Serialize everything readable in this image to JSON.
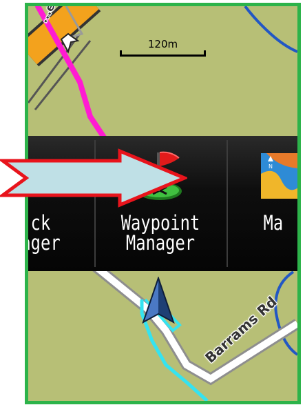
{
  "map": {
    "scale_label": "120m",
    "road_labels": {
      "top_street": "...ent Ra",
      "bottom_street": "Barrams Rd"
    }
  },
  "menu": {
    "items": [
      {
        "label": "ck\nager",
        "icon": "track-icon"
      },
      {
        "label": "Waypoint\nManager",
        "icon": "waypoint-flag-icon"
      },
      {
        "label": "Ma",
        "icon": "map-icon"
      }
    ]
  },
  "colors": {
    "frame": "#2db34a",
    "callout_fill": "#bfe0e6",
    "callout_stroke": "#e8141c",
    "track": "#ff1bd2",
    "route": "#35e3f0",
    "map_land": "#b7bf76"
  },
  "icons": [
    "waypoint-flag-icon",
    "map-icon",
    "position-arrow-icon",
    "callout-arrow-icon"
  ]
}
